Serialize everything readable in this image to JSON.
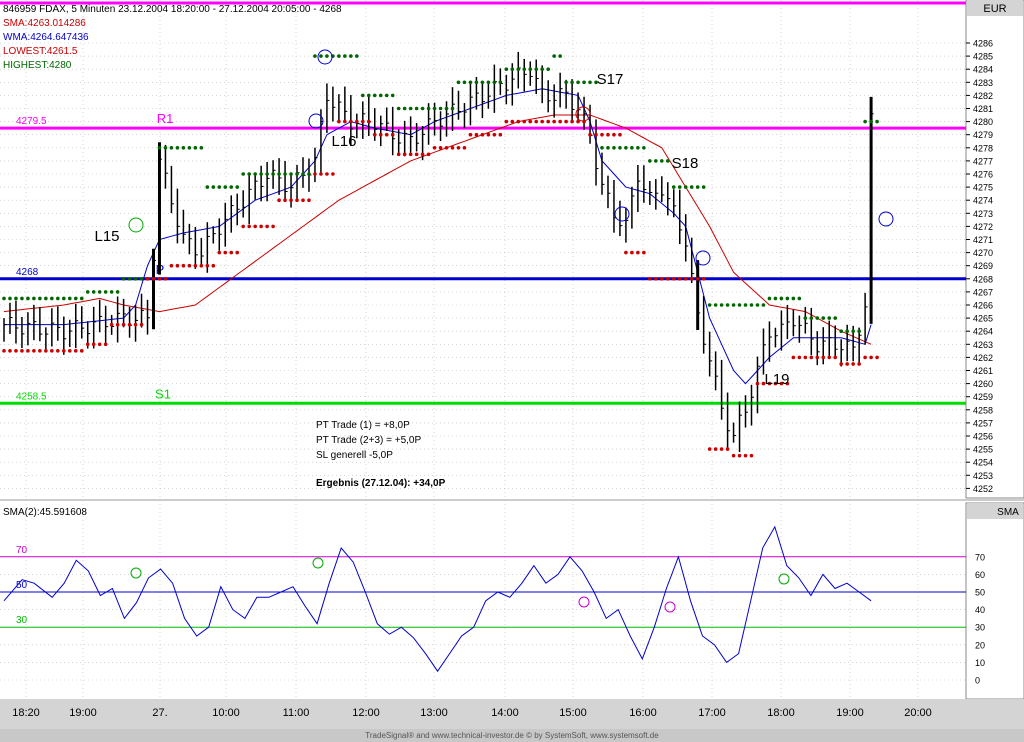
{
  "window": {
    "header_text": "846959  FDAX, 5 Minuten  23.12.2004 18:20:00 - 27.12.2004 20:05:00 - 4268",
    "currency_label": "EUR",
    "lower_panel_label": "SMA",
    "footer": "TradeSignal® and www.technical-investor.de © by  SystemSoft, www.systemsoft.de"
  },
  "indicators": {
    "sma": "SMA:4263.014286",
    "wma": "WMA:4264.647436",
    "lowest": "LOWEST:4261.5",
    "highest": "HIGHEST:4280",
    "sma2": "SMA(2):45.591608"
  },
  "colors": {
    "bars": "#000000",
    "sma_line": "#cc0000",
    "wma_line": "#0000cc",
    "highest_dots": "#006600",
    "lowest_dots": "#cc0000",
    "r1": "#ff00ff",
    "p": "#0000cc",
    "s1": "#00dd00",
    "osc_line": "#0000cc"
  },
  "notes": {
    "line1": "PT Trade (1) = +8,0P",
    "line2": "PT Trade (2+3) = +5,0P",
    "line3": "SL generell -5,0P",
    "result": "Ergebnis (27.12.04):  +34,0P"
  },
  "chart_data": [
    {
      "type": "ohlc",
      "ylim": [
        4251.5,
        4287
      ],
      "y_ticks": [
        4252,
        4253,
        4254,
        4255,
        4256,
        4257,
        4258,
        4259,
        4260,
        4261,
        4262,
        4263,
        4264,
        4265,
        4266,
        4267,
        4268,
        4269,
        4270,
        4271,
        4272,
        4273,
        4274,
        4275,
        4276,
        4277,
        4278,
        4279,
        4280,
        4281,
        4282,
        4283,
        4284,
        4285,
        4286
      ],
      "x_tick_labels": [
        "18:20",
        "19:00",
        "27.",
        "10:00",
        "11:00",
        "12:00",
        "13:00",
        "14:00",
        "15:00",
        "16:00",
        "17:00",
        "18:00",
        "19:00",
        "20:00"
      ],
      "levels": [
        {
          "name": "R1",
          "value_label": "4279.5",
          "value": 4279.5
        },
        {
          "name": "P",
          "value_label": "4268",
          "value": 4268
        },
        {
          "name": "S1",
          "value_label": "4258.5",
          "value": 4258.5
        }
      ],
      "annotations": [
        "L15",
        "L16",
        "S17",
        "S18",
        "L19"
      ],
      "close_path": [
        [
          0,
          4264.5
        ],
        [
          10,
          4264
        ],
        [
          20,
          4265
        ],
        [
          24,
          4265
        ],
        [
          25,
          4270
        ],
        [
          26,
          4277
        ],
        [
          28,
          4274
        ],
        [
          30,
          4271
        ],
        [
          33,
          4270
        ],
        [
          36,
          4272
        ],
        [
          40,
          4274
        ],
        [
          44,
          4276
        ],
        [
          48,
          4275
        ],
        [
          50,
          4276
        ],
        [
          52,
          4277
        ],
        [
          54,
          4282
        ],
        [
          56,
          4281
        ],
        [
          58,
          4280
        ],
        [
          62,
          4280
        ],
        [
          65,
          4279
        ],
        [
          68,
          4278.5
        ],
        [
          72,
          4280
        ],
        [
          76,
          4281
        ],
        [
          80,
          4282
        ],
        [
          84,
          4283
        ],
        [
          88,
          4284
        ],
        [
          90,
          4282
        ],
        [
          94,
          4282
        ],
        [
          96,
          4281
        ],
        [
          98,
          4279
        ],
        [
          100,
          4275
        ],
        [
          102,
          4273
        ],
        [
          104,
          4272
        ],
        [
          106,
          4276
        ],
        [
          108,
          4274
        ],
        [
          110,
          4275
        ],
        [
          112,
          4273
        ],
        [
          114,
          4271
        ],
        [
          116,
          4265
        ],
        [
          118,
          4262
        ],
        [
          120,
          4258
        ],
        [
          122,
          4256
        ],
        [
          124,
          4258
        ],
        [
          126,
          4261
        ],
        [
          128,
          4264
        ],
        [
          130,
          4264
        ],
        [
          132,
          4265
        ],
        [
          134,
          4264
        ],
        [
          136,
          4263
        ],
        [
          140,
          4263
        ],
        [
          142,
          4262.5
        ],
        [
          144,
          4266
        ],
        [
          145,
          4280
        ]
      ],
      "sma_path": [
        [
          0,
          4265.5
        ],
        [
          10,
          4266
        ],
        [
          16,
          4266.5
        ],
        [
          20,
          4266
        ],
        [
          26,
          4265.5
        ],
        [
          32,
          4266
        ],
        [
          38,
          4268
        ],
        [
          44,
          4270
        ],
        [
          50,
          4272
        ],
        [
          56,
          4274
        ],
        [
          62,
          4275.5
        ],
        [
          68,
          4277
        ],
        [
          74,
          4278
        ],
        [
          80,
          4279
        ],
        [
          86,
          4280
        ],
        [
          92,
          4280.5
        ],
        [
          98,
          4280.5
        ],
        [
          104,
          4279.5
        ],
        [
          110,
          4278
        ],
        [
          114,
          4275
        ],
        [
          118,
          4272
        ],
        [
          122,
          4268.5
        ],
        [
          128,
          4266
        ],
        [
          134,
          4265.5
        ],
        [
          140,
          4264
        ],
        [
          145,
          4263
        ]
      ],
      "wma_path": [
        [
          0,
          4264.5
        ],
        [
          10,
          4264.5
        ],
        [
          20,
          4265
        ],
        [
          22,
          4266
        ],
        [
          24,
          4269
        ],
        [
          26,
          4271
        ],
        [
          30,
          4271.5
        ],
        [
          36,
          4272
        ],
        [
          42,
          4274
        ],
        [
          48,
          4275
        ],
        [
          52,
          4277
        ],
        [
          54,
          4279
        ],
        [
          58,
          4280
        ],
        [
          62,
          4279.5
        ],
        [
          68,
          4279
        ],
        [
          72,
          4280
        ],
        [
          78,
          4281
        ],
        [
          84,
          4282
        ],
        [
          90,
          4282.5
        ],
        [
          96,
          4282
        ],
        [
          98,
          4280
        ],
        [
          100,
          4277
        ],
        [
          104,
          4275
        ],
        [
          108,
          4274.5
        ],
        [
          112,
          4273
        ],
        [
          114,
          4272
        ],
        [
          118,
          4265
        ],
        [
          122,
          4261
        ],
        [
          124,
          4260
        ],
        [
          128,
          4262
        ],
        [
          132,
          4263.5
        ],
        [
          140,
          4263.5
        ],
        [
          144,
          4263
        ],
        [
          145,
          4264.5
        ]
      ],
      "highest_dots": [
        [
          0,
          4266.5
        ],
        [
          14,
          4267
        ],
        [
          20,
          4268
        ],
        [
          26,
          4278
        ],
        [
          34,
          4275
        ],
        [
          40,
          4276
        ],
        [
          46,
          4276
        ],
        [
          52,
          4285
        ],
        [
          60,
          4282
        ],
        [
          66,
          4281
        ],
        [
          76,
          4283
        ],
        [
          84,
          4284
        ],
        [
          92,
          4285
        ],
        [
          94,
          4283
        ],
        [
          100,
          4278
        ],
        [
          108,
          4277
        ],
        [
          112,
          4275
        ],
        [
          118,
          4266
        ],
        [
          124,
          4266
        ],
        [
          128,
          4266.5
        ],
        [
          134,
          4265
        ],
        [
          140,
          4264
        ],
        [
          144,
          4280
        ]
      ],
      "lowest_dots": [
        [
          0,
          4262.5
        ],
        [
          14,
          4263
        ],
        [
          18,
          4264.5
        ],
        [
          24,
          4268
        ],
        [
          28,
          4269
        ],
        [
          36,
          4270
        ],
        [
          40,
          4272
        ],
        [
          46,
          4274
        ],
        [
          52,
          4276
        ],
        [
          56,
          4280
        ],
        [
          62,
          4279
        ],
        [
          66,
          4277.5
        ],
        [
          72,
          4278
        ],
        [
          78,
          4279
        ],
        [
          84,
          4280
        ],
        [
          90,
          4280
        ],
        [
          98,
          4279
        ],
        [
          104,
          4270
        ],
        [
          108,
          4268
        ],
        [
          118,
          4255
        ],
        [
          122,
          4254.5
        ],
        [
          126,
          4260
        ],
        [
          132,
          4262
        ],
        [
          140,
          4261.5
        ],
        [
          144,
          4262
        ]
      ]
    },
    {
      "type": "line",
      "title": "SMA(2):45.591608",
      "ylim": [
        -5,
        80
      ],
      "y_ticks": [
        0,
        10,
        20,
        30,
        40,
        50,
        60,
        70
      ],
      "levels": [
        70,
        50,
        30
      ],
      "values": [
        [
          0,
          45
        ],
        [
          3,
          57
        ],
        [
          5,
          55
        ],
        [
          8,
          47
        ],
        [
          10,
          55
        ],
        [
          12,
          68
        ],
        [
          14,
          62
        ],
        [
          16,
          48
        ],
        [
          18,
          52
        ],
        [
          20,
          35
        ],
        [
          22,
          44
        ],
        [
          24,
          58
        ],
        [
          26,
          63
        ],
        [
          28,
          55
        ],
        [
          30,
          35
        ],
        [
          32,
          25
        ],
        [
          34,
          30
        ],
        [
          36,
          53
        ],
        [
          38,
          40
        ],
        [
          40,
          35
        ],
        [
          42,
          47
        ],
        [
          44,
          47
        ],
        [
          46,
          50
        ],
        [
          48,
          53
        ],
        [
          50,
          42
        ],
        [
          52,
          32
        ],
        [
          54,
          55
        ],
        [
          56,
          75
        ],
        [
          58,
          67
        ],
        [
          60,
          50
        ],
        [
          62,
          32
        ],
        [
          64,
          26
        ],
        [
          66,
          30
        ],
        [
          68,
          24
        ],
        [
          70,
          15
        ],
        [
          72,
          5
        ],
        [
          74,
          15
        ],
        [
          76,
          25
        ],
        [
          78,
          30
        ],
        [
          80,
          45
        ],
        [
          82,
          50
        ],
        [
          84,
          47
        ],
        [
          86,
          55
        ],
        [
          88,
          65
        ],
        [
          90,
          55
        ],
        [
          92,
          60
        ],
        [
          94,
          70
        ],
        [
          96,
          62
        ],
        [
          98,
          50
        ],
        [
          100,
          35
        ],
        [
          102,
          40
        ],
        [
          104,
          25
        ],
        [
          106,
          12
        ],
        [
          108,
          30
        ],
        [
          110,
          52
        ],
        [
          112,
          70
        ],
        [
          114,
          45
        ],
        [
          116,
          25
        ],
        [
          118,
          20
        ],
        [
          120,
          10
        ],
        [
          122,
          15
        ],
        [
          124,
          45
        ],
        [
          126,
          75
        ],
        [
          128,
          87
        ],
        [
          130,
          65
        ],
        [
          132,
          58
        ],
        [
          134,
          48
        ],
        [
          136,
          60
        ],
        [
          138,
          52
        ],
        [
          140,
          55
        ],
        [
          142,
          50
        ],
        [
          144,
          45
        ]
      ]
    }
  ]
}
